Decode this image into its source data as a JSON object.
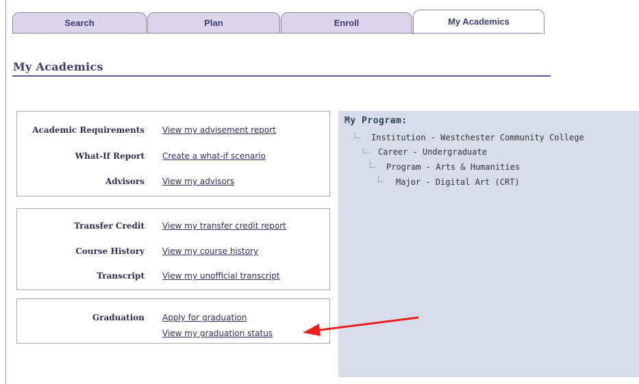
{
  "tabs": [
    {
      "label": "Search",
      "active": false
    },
    {
      "label": "Plan",
      "active": false
    },
    {
      "label": "Enroll",
      "active": false
    },
    {
      "label": "My Academics",
      "active": true
    }
  ],
  "page": {
    "title": "My Academics"
  },
  "sections": {
    "academic": [
      {
        "label": "Academic Requirements",
        "link": "View my advisement report"
      },
      {
        "label": "What-If Report",
        "link": "Create a what-if scenario"
      },
      {
        "label": "Advisors",
        "link": "View my advisors"
      }
    ],
    "records": [
      {
        "label": "Transfer Credit",
        "link": "View my transfer credit report"
      },
      {
        "label": "Course History",
        "link": "View my course history"
      },
      {
        "label": "Transcript",
        "link": "View my unofficial transcript"
      }
    ],
    "graduation": {
      "label": "Graduation",
      "links": [
        "Apply for graduation",
        "View my graduation status"
      ]
    }
  },
  "program": {
    "heading": "My Program:",
    "tree": [
      "Institution - Westchester Community College",
      "Career - Undergraduate",
      "Program - Arts & Humanities",
      "Major - Digital Art (CRT)"
    ]
  },
  "colors": {
    "tab_bg": "#ddd5ea",
    "tab_text": "#3c3c7a",
    "panel_bg": "#d6dde8",
    "arrow": "#e8201c"
  }
}
